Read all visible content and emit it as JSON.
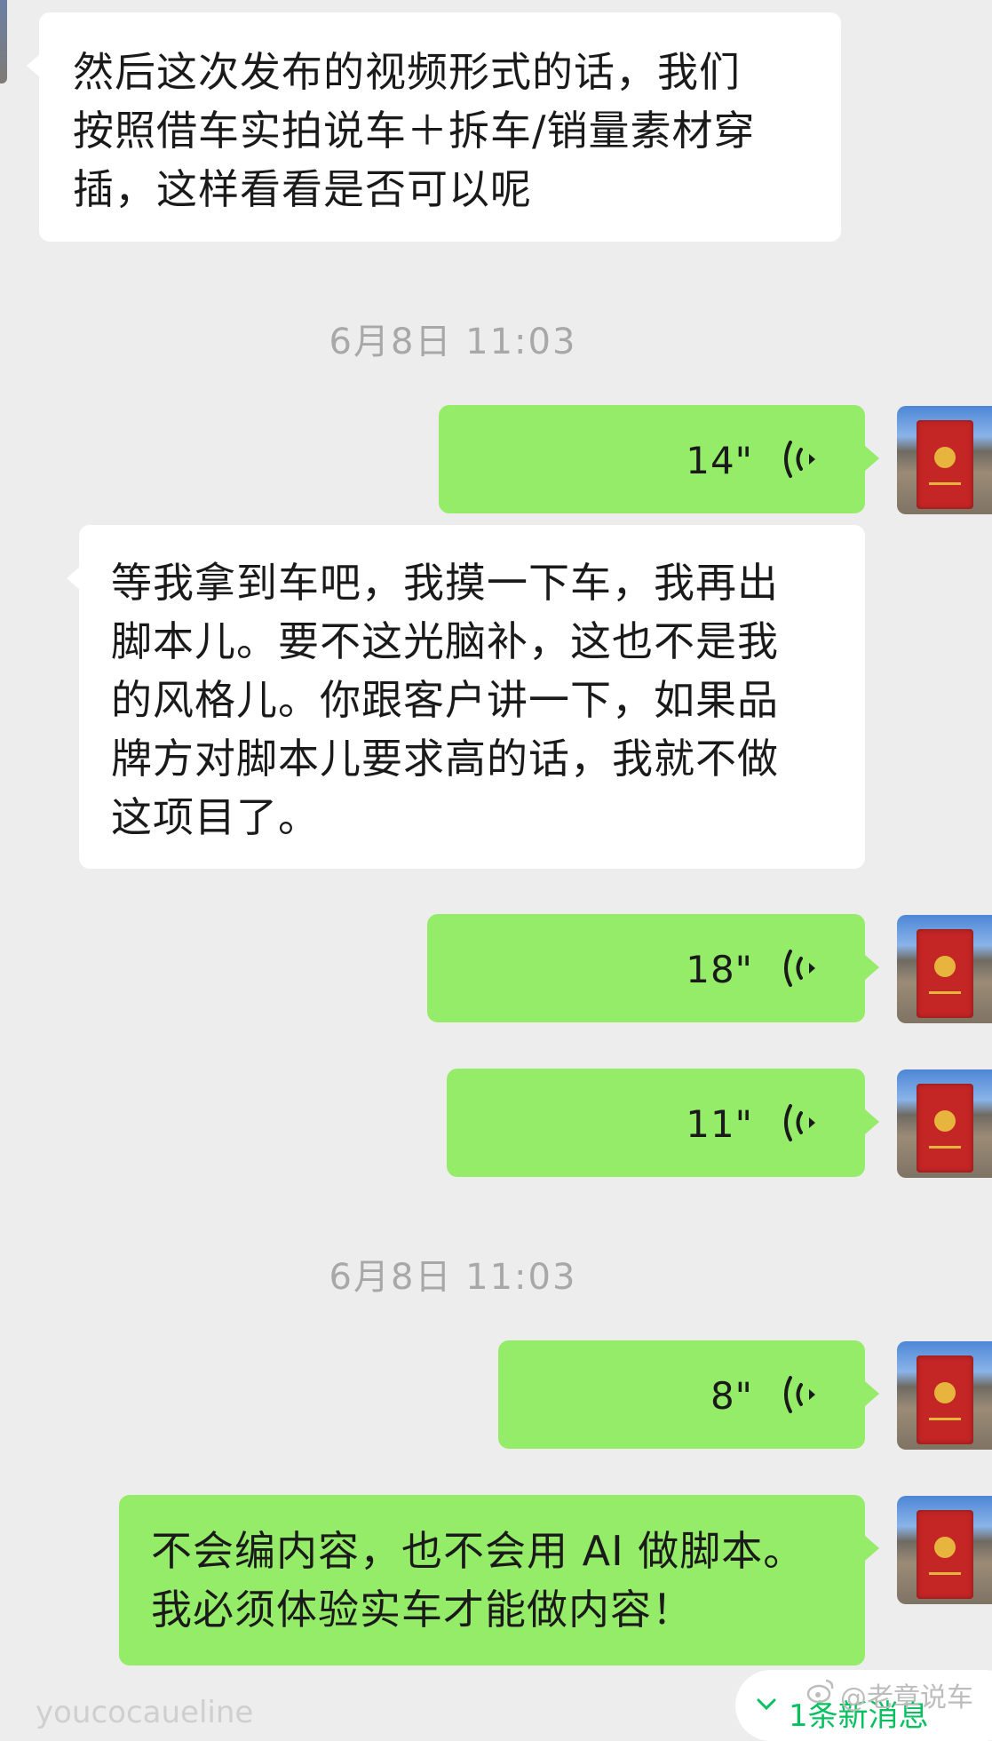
{
  "messages": {
    "m1_text": "然后这次发布的视频形式的话，我们\n按照借车实拍说车＋拆车/销量素材穿\n插，这样看看是否可以呢",
    "timestamp1": "6月8日 11:03",
    "voice1": "14\"",
    "m2_text": "等我拿到车吧，我摸一下车，我再出\n脚本儿。要不这光脑补，这也不是我\n的风格儿。你跟客户讲一下，如果品\n牌方对脚本儿要求高的话，我就不做\n这项目了。",
    "voice2": "18\"",
    "voice3": "11\"",
    "timestamp2": "6月8日 11:03",
    "voice4": "8\"",
    "m3_text": "不会编内容，也不会用 AI 做脚本。\n我必须体验实车才能做内容！"
  },
  "footer": {
    "watermark": "@老章说车",
    "new_messages": "1条新消息",
    "partial_name": "youcocaueline"
  },
  "colors": {
    "chat_bg": "#ededed",
    "incoming_bubble": "#ffffff",
    "outgoing_bubble": "#95ec69"
  },
  "icons": {
    "voice": "voice-wave-icon",
    "new_messages": "chevron-down-icon",
    "watermark": "weibo-icon"
  }
}
